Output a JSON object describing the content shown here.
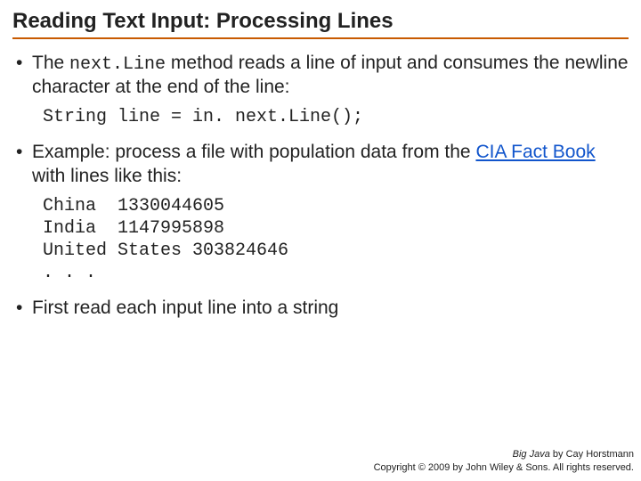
{
  "title": "Reading Text Input: Processing Lines",
  "bullet1": {
    "pre": "The ",
    "code": "next.Line",
    "post": " method reads a line of input and consumes the newline character at the end of the line:"
  },
  "code1": "String line = in. next.Line();",
  "bullet2": {
    "pre": "Example: process a file with population data from the ",
    "link": "CIA Fact Book",
    "post": " with lines like this:"
  },
  "code2": "China  1330044605\nIndia  1147995898\nUnited States 303824646\n. . .",
  "bullet3": "First read each input line into a string",
  "footer": {
    "book": "Big Java",
    "author": " by Cay Horstmann",
    "copyright": "Copyright © 2009 by John Wiley & Sons.  All rights reserved."
  }
}
